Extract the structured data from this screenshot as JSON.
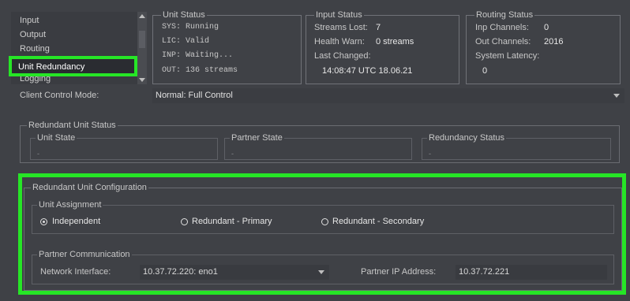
{
  "nav": {
    "items": [
      "Input",
      "Output",
      "Routing",
      "Unit Redundancy",
      "Logging"
    ],
    "selected": "Unit Redundancy"
  },
  "unit_status": {
    "title": "Unit Status",
    "lines": [
      "SYS: Running",
      "LIC: Valid",
      "INP: Waiting...",
      "OUT: 136 streams"
    ]
  },
  "input_status": {
    "title": "Input Status",
    "streams_lost_label": "Streams Lost:",
    "streams_lost_value": "7",
    "health_warn_label": "Health Warn:",
    "health_warn_value": "0 streams",
    "last_changed_label": "Last Changed:",
    "last_changed_value": "14:08:47 UTC 18.06.21"
  },
  "routing_status": {
    "title": "Routing Status",
    "inp_channels_label": "Inp Channels:",
    "inp_channels_value": "0",
    "out_channels_label": "Out Channels:",
    "out_channels_value": "2016",
    "latency_label": "System Latency:",
    "latency_value": "0"
  },
  "client_control": {
    "label": "Client Control Mode:",
    "value": "Normal: Full Control"
  },
  "redundant_status": {
    "title": "Redundant Unit Status",
    "unit_state_label": "Unit State",
    "unit_state_value": "-",
    "partner_state_label": "Partner State",
    "partner_state_value": "-",
    "redundancy_status_label": "Redundancy Status",
    "redundancy_status_value": "-"
  },
  "config": {
    "title": "Redundant Unit Configuration",
    "assignment_title": "Unit Assignment",
    "options": [
      "Independent",
      "Redundant - Primary",
      "Redundant - Secondary"
    ],
    "selected_option": "Independent",
    "partner_title": "Partner Communication",
    "network_interface_label": "Network Interface:",
    "network_interface_value": "10.37.72.220: eno1",
    "partner_ip_label": "Partner IP Address:",
    "partner_ip_value": "10.37.72.221"
  },
  "colors": {
    "highlight": "#26e626",
    "background": "#3f4146"
  }
}
